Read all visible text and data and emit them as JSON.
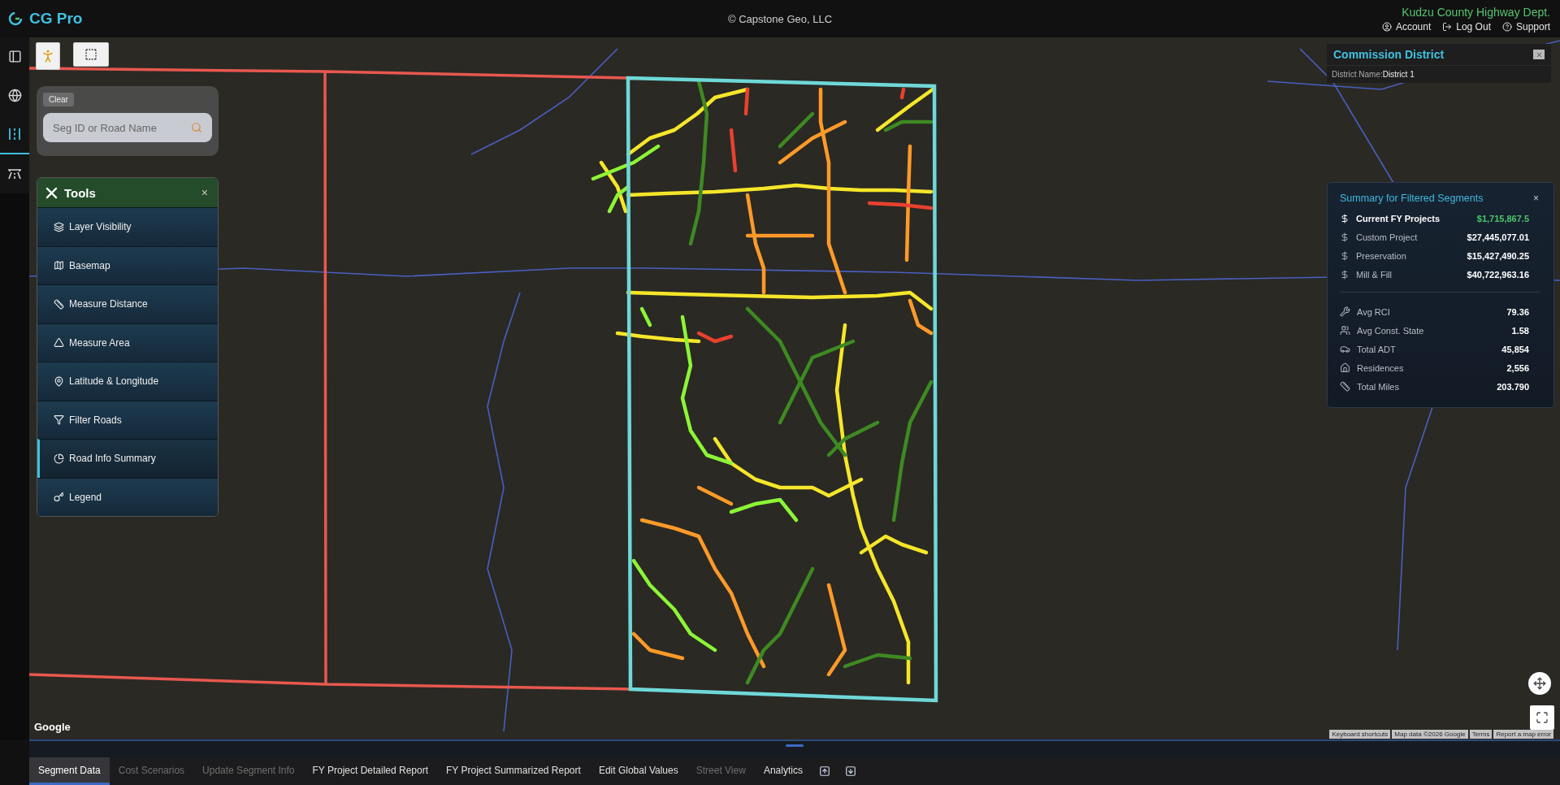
{
  "header": {
    "logo_text": "CG Pro",
    "copyright": "© Capstone Geo, LLC",
    "org": "Kudzu County Highway Dept.",
    "links": [
      {
        "kind": "account",
        "label": "Account"
      },
      {
        "kind": "logout",
        "label": "Log Out"
      },
      {
        "kind": "support",
        "label": "Support"
      }
    ]
  },
  "rail": [
    {
      "kind": "panel",
      "selected": false
    },
    {
      "kind": "globe",
      "selected": false
    },
    {
      "kind": "lanes",
      "selected": true
    },
    {
      "kind": "highway",
      "selected": false
    }
  ],
  "search": {
    "clear_label": "Clear",
    "placeholder": "Seg ID or Road Name"
  },
  "tools": {
    "title": "Tools",
    "close": "×",
    "items": [
      {
        "kind": "layers",
        "label": "Layer Visibility",
        "selected": false
      },
      {
        "kind": "basemap",
        "label": "Basemap",
        "selected": false
      },
      {
        "kind": "distance",
        "label": "Measure Distance",
        "selected": false
      },
      {
        "kind": "area",
        "label": "Measure Area",
        "selected": false
      },
      {
        "kind": "latlng",
        "label": "Latitude & Longitude",
        "selected": false
      },
      {
        "kind": "filter",
        "label": "Filter Roads",
        "selected": false
      },
      {
        "kind": "summary",
        "label": "Road Info Summary",
        "selected": true
      },
      {
        "kind": "legend",
        "label": "Legend",
        "selected": false
      }
    ]
  },
  "district": {
    "title": "Commission District",
    "field_label": "District Name:",
    "field_value": "District 1"
  },
  "summary": {
    "title": "Summary for Filtered Segments",
    "close": "×",
    "costs": [
      {
        "label": "Current FY Projects",
        "value": "$1,715,867.5",
        "highlight": true
      },
      {
        "label": "Custom Project",
        "value": "$27,445,077.01",
        "highlight": false
      },
      {
        "label": "Preservation",
        "value": "$15,427,490.25",
        "highlight": false
      },
      {
        "label": "Mill & Fill",
        "value": "$40,722,963.16",
        "highlight": false
      }
    ],
    "stats": [
      {
        "kind": "rci",
        "label": "Avg RCI",
        "value": "79.36"
      },
      {
        "kind": "state",
        "label": "Avg Const. State",
        "value": "1.58"
      },
      {
        "kind": "adt",
        "label": "Total ADT",
        "value": "45,854"
      },
      {
        "kind": "residences",
        "label": "Residences",
        "value": "2,556"
      },
      {
        "kind": "miles",
        "label": "Total Miles",
        "value": "203.790"
      }
    ]
  },
  "map": {
    "brand": "Google",
    "footer_links": [
      "Keyboard shortcuts",
      "Map data ©2026 Google",
      "Terms",
      "Report a map error"
    ]
  },
  "tabs": [
    {
      "kind": "text",
      "label": "Segment Data",
      "selected": true,
      "disabled": false
    },
    {
      "kind": "text",
      "label": "Cost Scenarios",
      "selected": false,
      "disabled": true
    },
    {
      "kind": "text",
      "label": "Update Segment Info",
      "selected": false,
      "disabled": true
    },
    {
      "kind": "text",
      "label": "FY Project Detailed Report",
      "selected": false,
      "disabled": false
    },
    {
      "kind": "text",
      "label": "FY Project Summarized Report",
      "selected": false,
      "disabled": false
    },
    {
      "kind": "text",
      "label": "Edit Global Values",
      "selected": false,
      "disabled": false
    },
    {
      "kind": "text",
      "label": "Street View",
      "selected": false,
      "disabled": true
    },
    {
      "kind": "text",
      "label": "Analytics",
      "selected": false,
      "disabled": false
    },
    {
      "kind": "up"
    },
    {
      "kind": "down"
    }
  ]
}
